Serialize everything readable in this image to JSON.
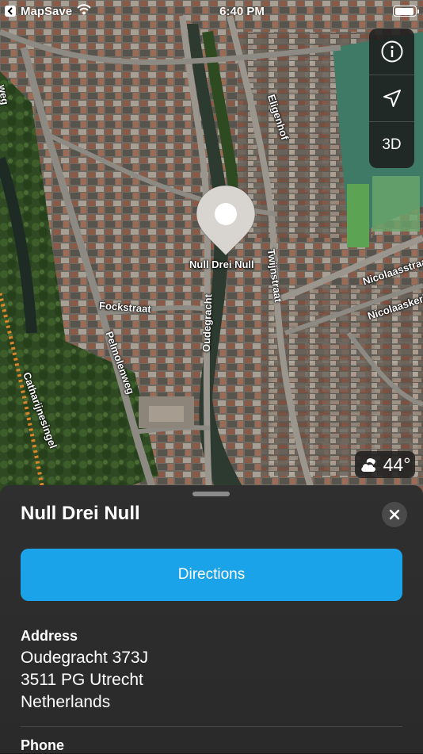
{
  "status_bar": {
    "back_app": "MapSave",
    "time": "6:40 PM",
    "battery_level": 0.95
  },
  "map": {
    "road_labels": [
      {
        "id": "eligenhof",
        "text": "Eligenhof"
      },
      {
        "id": "null-drei-null",
        "text": "Null Drei Null"
      },
      {
        "id": "twijnstraat",
        "text": "Twijnstraat"
      },
      {
        "id": "nicolaasstraat",
        "text": "Nicolaasstraat"
      },
      {
        "id": "nicolaaskerkhof",
        "text": "Nicolaaskerkhof"
      },
      {
        "id": "fockstraat",
        "text": "Fockstraat"
      },
      {
        "id": "oudegracht",
        "text": "Oudegracht"
      },
      {
        "id": "pelmolenweg",
        "text": "Pelmolenweg"
      },
      {
        "id": "catharijnesingel",
        "text": "Catharijnesingel"
      },
      {
        "id": "edge",
        "text": "weg"
      }
    ],
    "controls": {
      "info_icon": "info-icon",
      "location_icon": "location-arrow-icon",
      "three_d_label": "3D"
    },
    "weather": {
      "icon": "partly-cloudy-night-icon",
      "temperature": "44°"
    }
  },
  "sheet": {
    "title": "Null Drei Null",
    "directions_label": "Directions",
    "address_label": "Address",
    "address_lines": [
      "Oudegracht 373J",
      "3511 PG Utrecht",
      "Netherlands"
    ],
    "phone_label": "Phone"
  },
  "colors": {
    "accent": "#1aa3e8",
    "sheet_bg": "#2e2e2e"
  }
}
